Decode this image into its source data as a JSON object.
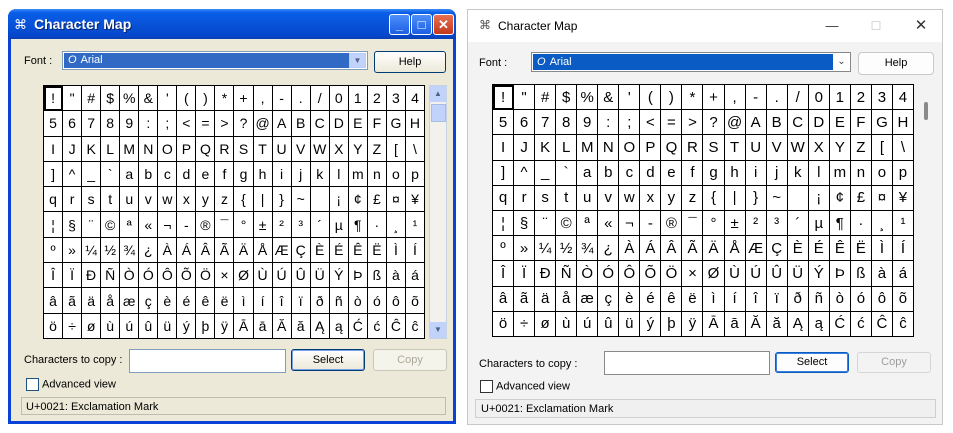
{
  "app_title": "Character Map",
  "font_label": "Font :",
  "font_value": "Arial",
  "help_label": "Help",
  "copy_label": "Characters to copy :",
  "copy_value": "",
  "select_label": "Select",
  "copy_button_label": "Copy",
  "advanced_label": "Advanced view",
  "status_text": "U+0021: Exclamation Mark",
  "xp_titlebar_color": "#0a5ee8",
  "w11_selection_color": "#0a5bc4",
  "characters": [
    "!",
    "\"",
    "#",
    "$",
    "%",
    "&",
    "'",
    "(",
    ")",
    "*",
    "+",
    ",",
    "-",
    ".",
    "/",
    "0",
    "1",
    "2",
    "3",
    "4",
    "5",
    "6",
    "7",
    "8",
    "9",
    ":",
    ";",
    "<",
    "=",
    ">",
    "?",
    "@",
    "A",
    "B",
    "C",
    "D",
    "E",
    "F",
    "G",
    "H",
    "I",
    "J",
    "K",
    "L",
    "M",
    "N",
    "O",
    "P",
    "Q",
    "R",
    "S",
    "T",
    "U",
    "V",
    "W",
    "X",
    "Y",
    "Z",
    "[",
    "\\",
    "]",
    "^",
    "_",
    "`",
    "a",
    "b",
    "c",
    "d",
    "e",
    "f",
    "g",
    "h",
    "i",
    "j",
    "k",
    "l",
    "m",
    "n",
    "o",
    "p",
    "q",
    "r",
    "s",
    "t",
    "u",
    "v",
    "w",
    "x",
    "y",
    "z",
    "{",
    "|",
    "}",
    "~",
    " ",
    "¡",
    "¢",
    "£",
    "¤",
    "¥",
    "¦",
    "§",
    "¨",
    "©",
    "ª",
    "«",
    "¬",
    "-",
    "®",
    "¯",
    "°",
    "±",
    "²",
    "³",
    "´",
    "µ",
    "¶",
    "·",
    "¸",
    "¹",
    "º",
    "»",
    "¼",
    "½",
    "¾",
    "¿",
    "À",
    "Á",
    "Â",
    "Ã",
    "Ä",
    "Å",
    "Æ",
    "Ç",
    "È",
    "É",
    "Ê",
    "Ë",
    "Ì",
    "Í",
    "Î",
    "Ï",
    "Ð",
    "Ñ",
    "Ò",
    "Ó",
    "Ô",
    "Õ",
    "Ö",
    "×",
    "Ø",
    "Ù",
    "Ú",
    "Û",
    "Ü",
    "Ý",
    "Þ",
    "ß",
    "à",
    "á",
    "â",
    "ã",
    "ä",
    "å",
    "æ",
    "ç",
    "è",
    "é",
    "ê",
    "ë",
    "ì",
    "í",
    "î",
    "ï",
    "ð",
    "ñ",
    "ò",
    "ó",
    "ô",
    "õ",
    "ö",
    "÷",
    "ø",
    "ù",
    "ú",
    "û",
    "ü",
    "ý",
    "þ",
    "ÿ",
    "Ā",
    "ā",
    "Ă",
    "ă",
    "Ą",
    "ą",
    "Ć",
    "ć",
    "Ĉ",
    "ĉ"
  ],
  "selected_index": 0
}
